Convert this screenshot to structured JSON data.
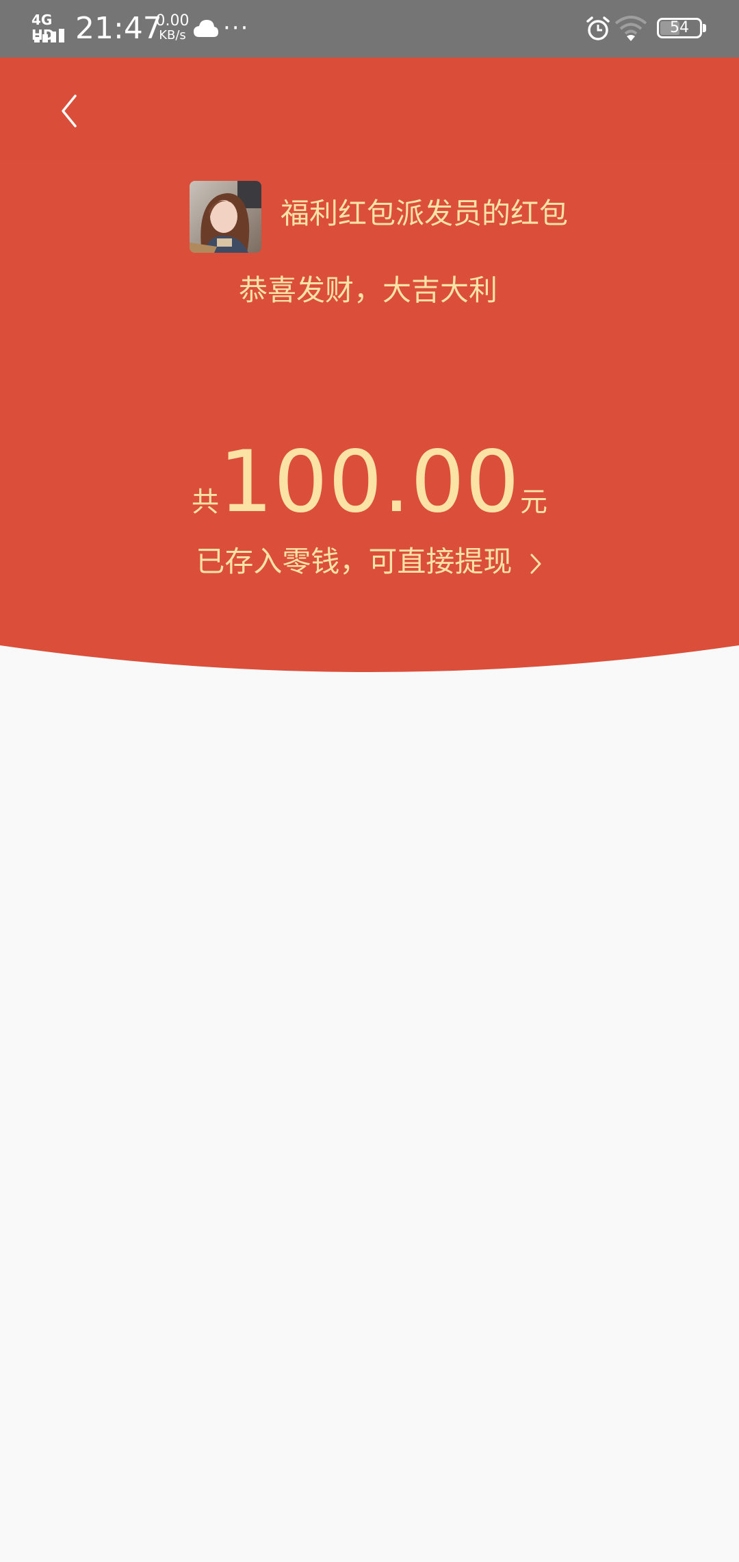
{
  "status_bar": {
    "network": "4G HD",
    "time": "21:47",
    "speed_value": "0.00",
    "speed_unit": "KB/s",
    "more_indicator": "···",
    "battery_level": "54",
    "battery_fraction": 0.54
  },
  "header": {
    "back_icon": "chevron-left-icon"
  },
  "red_packet": {
    "sender_title": "福利红包派发员的红包",
    "greeting": "恭喜发财，大吉大利",
    "amount_prefix": "共",
    "amount": "100.00",
    "amount_suffix": "元",
    "wallet_link": "已存入零钱，可直接提现"
  },
  "colors": {
    "status_bar_bg": "#757575",
    "envelope_red": "#db4e3a",
    "gold_text": "#fbe2a5",
    "page_bg": "#f9f9f9"
  }
}
